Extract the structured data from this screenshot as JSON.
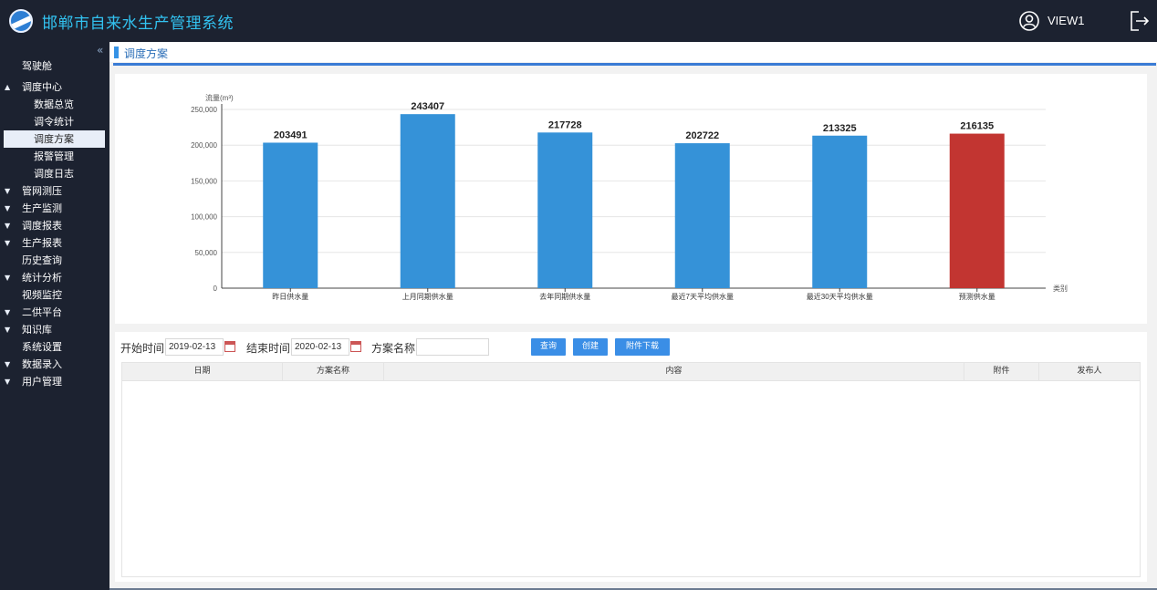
{
  "app": {
    "title": "邯郸市自来水生产管理系统",
    "user_name": "VIEW1",
    "colors": {
      "header_bg": "#1c2230",
      "title": "#32c2f0",
      "accent": "#3a8ee6",
      "bar_blue": "#3592d8",
      "bar_red": "#c23531"
    }
  },
  "sidebar": {
    "collapse_icon": "«",
    "items": [
      {
        "label": "驾驶舱",
        "arrow": ""
      },
      {
        "label": "调度中心",
        "arrow": "▲"
      },
      {
        "label": "数据总览",
        "arrow": ""
      },
      {
        "label": "调令统计",
        "arrow": ""
      },
      {
        "label": "调度方案",
        "arrow": ""
      },
      {
        "label": "报警管理",
        "arrow": ""
      },
      {
        "label": "调度日志",
        "arrow": ""
      },
      {
        "label": "管网测压",
        "arrow": "▼"
      },
      {
        "label": "生产监测",
        "arrow": "▼"
      },
      {
        "label": "调度报表",
        "arrow": "▼"
      },
      {
        "label": "生产报表",
        "arrow": "▼"
      },
      {
        "label": "历史查询",
        "arrow": ""
      },
      {
        "label": "统计分析",
        "arrow": "▼"
      },
      {
        "label": "视频监控",
        "arrow": ""
      },
      {
        "label": "二供平台",
        "arrow": "▼"
      },
      {
        "label": "知识库",
        "arrow": "▼"
      },
      {
        "label": "系统设置",
        "arrow": ""
      },
      {
        "label": "数据录入",
        "arrow": "▼"
      },
      {
        "label": "用户管理",
        "arrow": "▼"
      }
    ]
  },
  "page": {
    "tab_title": "调度方案"
  },
  "chart_data": {
    "type": "bar",
    "ylabel": "流量(m³)",
    "xlabel": "类别",
    "ylim": [
      0,
      250000
    ],
    "yticks": [
      "0",
      "50,000",
      "100,000",
      "150,000",
      "200,000",
      "250,000"
    ],
    "categories": [
      "昨日供水量",
      "上月同期供水量",
      "去年同期供水量",
      "最近7天平均供水量",
      "最近30天平均供水量",
      "预测供水量"
    ],
    "values": [
      203491,
      243407,
      217728,
      202722,
      213325,
      216135
    ],
    "colors": [
      "#3592d8",
      "#3592d8",
      "#3592d8",
      "#3592d8",
      "#3592d8",
      "#c23531"
    ],
    "grid": true
  },
  "filter": {
    "start_label": "开始时间",
    "start_value": "2019-02-13",
    "end_label": "结束时间",
    "end_value": "2020-02-13",
    "name_label": "方案名称",
    "name_value": "",
    "query_button": "查询",
    "create_button": "创建",
    "download_button": "附件下载"
  },
  "table": {
    "columns": [
      "日期",
      "方案名称",
      "内容",
      "附件",
      "发布人"
    ],
    "rows": []
  }
}
